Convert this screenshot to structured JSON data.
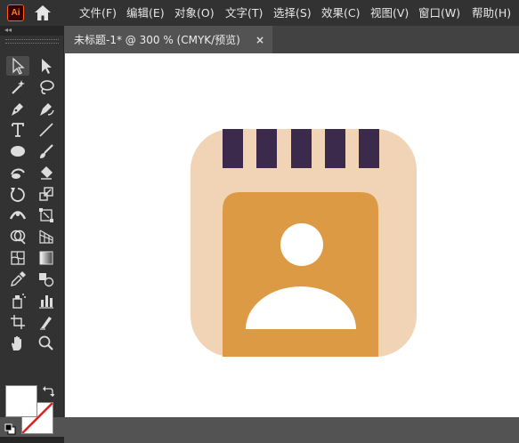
{
  "app": {
    "logo_text": "Ai"
  },
  "menu": {
    "items": [
      {
        "key": "file",
        "label": "文件(F)"
      },
      {
        "key": "edit",
        "label": "编辑(E)"
      },
      {
        "key": "object",
        "label": "对象(O)"
      },
      {
        "key": "type",
        "label": "文字(T)"
      },
      {
        "key": "select",
        "label": "选择(S)"
      },
      {
        "key": "effect",
        "label": "效果(C)"
      },
      {
        "key": "view",
        "label": "视图(V)"
      },
      {
        "key": "window",
        "label": "窗口(W)"
      },
      {
        "key": "help",
        "label": "帮助(H)"
      }
    ]
  },
  "toolbar": {
    "collapse_label": "◂◂",
    "tools": [
      "selection-tool",
      "direct-selection-tool",
      "magic-wand-tool",
      "lasso-tool",
      "pen-tool",
      "curvature-tool",
      "type-tool",
      "line-segment-tool",
      "rectangle-tool",
      "paintbrush-tool",
      "shaper-tool",
      "eraser-tool",
      "rotate-tool",
      "scale-tool",
      "width-tool",
      "free-transform-tool",
      "shape-builder-tool",
      "perspective-grid-tool",
      "mesh-tool",
      "gradient-tool",
      "eyedropper-tool",
      "blend-tool",
      "symbol-sprayer-tool",
      "column-graph-tool",
      "artboard-tool",
      "slice-tool",
      "hand-tool",
      "zoom-tool"
    ]
  },
  "document": {
    "tab_title": "未标题-1* @ 300 % (CMYK/预览)",
    "close_label": "×"
  },
  "colors": {
    "app_bar": "#323232",
    "canvas": "#ffffff",
    "icon_base": "#f1d4b6",
    "icon_stripes": "#3b2a4b",
    "icon_card": "#dc9a44",
    "icon_avatar": "#ffffff"
  }
}
